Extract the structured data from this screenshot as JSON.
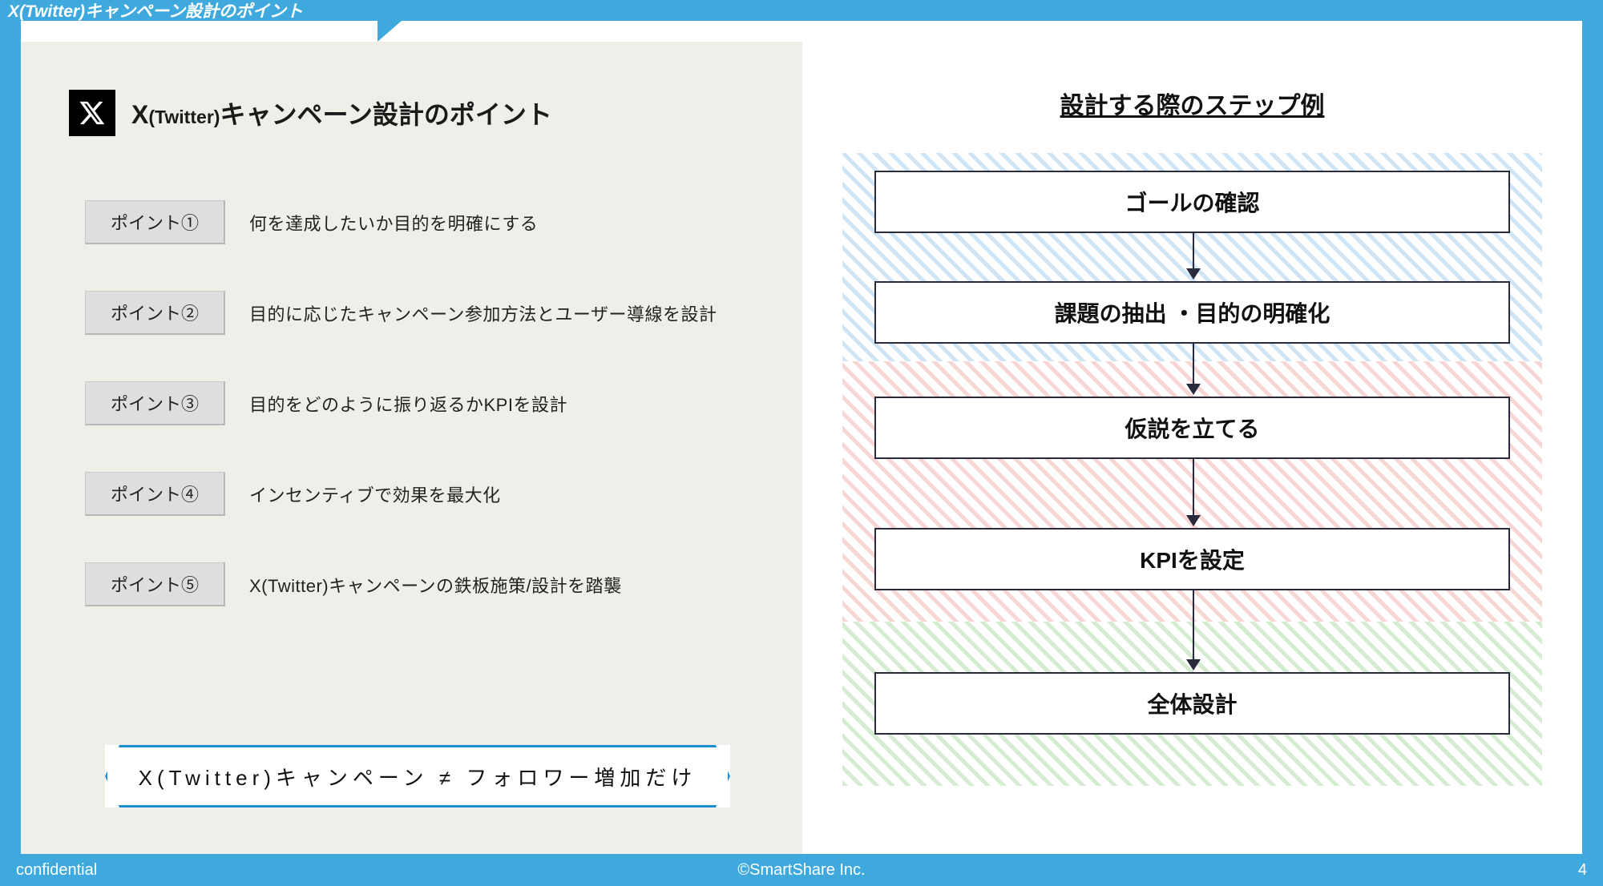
{
  "slide": {
    "tab_title": "X(Twitter)キャンペーン設計のポイント",
    "subheading_prefix_big": "X",
    "subheading_small": "(Twitter)",
    "subheading_rest": "キャンペーン設計のポイント",
    "points": [
      {
        "badge": "ポイント①",
        "desc": "何を達成したいか目的を明確にする"
      },
      {
        "badge": "ポイント②",
        "desc": "目的に応じたキャンペーン参加方法とユーザー導線を設計"
      },
      {
        "badge": "ポイント③",
        "desc": "目的をどのように振り返るかKPIを設計"
      },
      {
        "badge": "ポイント④",
        "desc": "インセンティブで効果を最大化"
      },
      {
        "badge": "ポイント⑤",
        "desc": "X(Twitter)キャンペーンの鉄板施策/設計を踏襲"
      }
    ],
    "callout": "X(Twitter)キャンペーン  ≠   フォロワー増加だけ",
    "right_title": "設計する際のステップ例",
    "flow": [
      "ゴールの確認",
      "課題の抽出 ・目的の明確化",
      "仮説を立てる",
      "KPIを設定",
      "全体設計"
    ],
    "footer": {
      "left": "confidential",
      "center": "©SmartShare Inc.",
      "page": "4"
    },
    "colors": {
      "brand": "#3fa9dd",
      "zone_blue": "#cfe4f4",
      "zone_red": "#f7d7d5",
      "zone_green": "#d6ecd2"
    }
  },
  "chart_data": {
    "type": "flow",
    "title": "設計する際のステップ例",
    "steps": [
      {
        "label": "ゴールの確認",
        "zone": "blue"
      },
      {
        "label": "課題の抽出 ・目的の明確化",
        "zone": "blue"
      },
      {
        "label": "仮説を立てる",
        "zone": "red"
      },
      {
        "label": "KPIを設定",
        "zone": "red"
      },
      {
        "label": "全体設計",
        "zone": "green"
      }
    ]
  }
}
